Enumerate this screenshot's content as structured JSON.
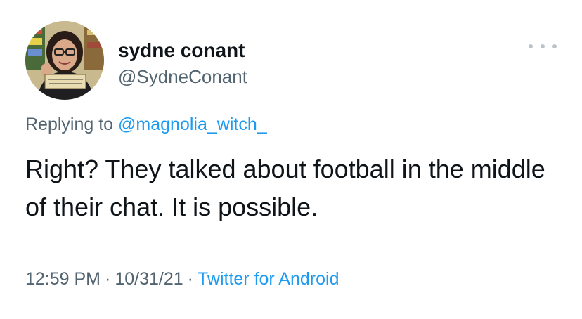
{
  "author": {
    "name": "sydne conant",
    "handle": "@SydneConant",
    "avatar_sign_text": "THIS SPACE IS INTENTIONALLY..."
  },
  "reply": {
    "prefix": "Replying to ",
    "to": "@magnolia_witch_"
  },
  "tweet": {
    "text": "Right? They talked about football in the middle of their chat. It is possible.",
    "time": "12:59 PM",
    "separator": "·",
    "date": "10/31/21",
    "source": "Twitter for Android"
  },
  "colors": {
    "text": "#0f1419",
    "secondary": "#536471",
    "link": "#1d9bf0",
    "more_dots": "#b8c3cb"
  },
  "icons": {
    "more": "more-horizontal-icon"
  }
}
